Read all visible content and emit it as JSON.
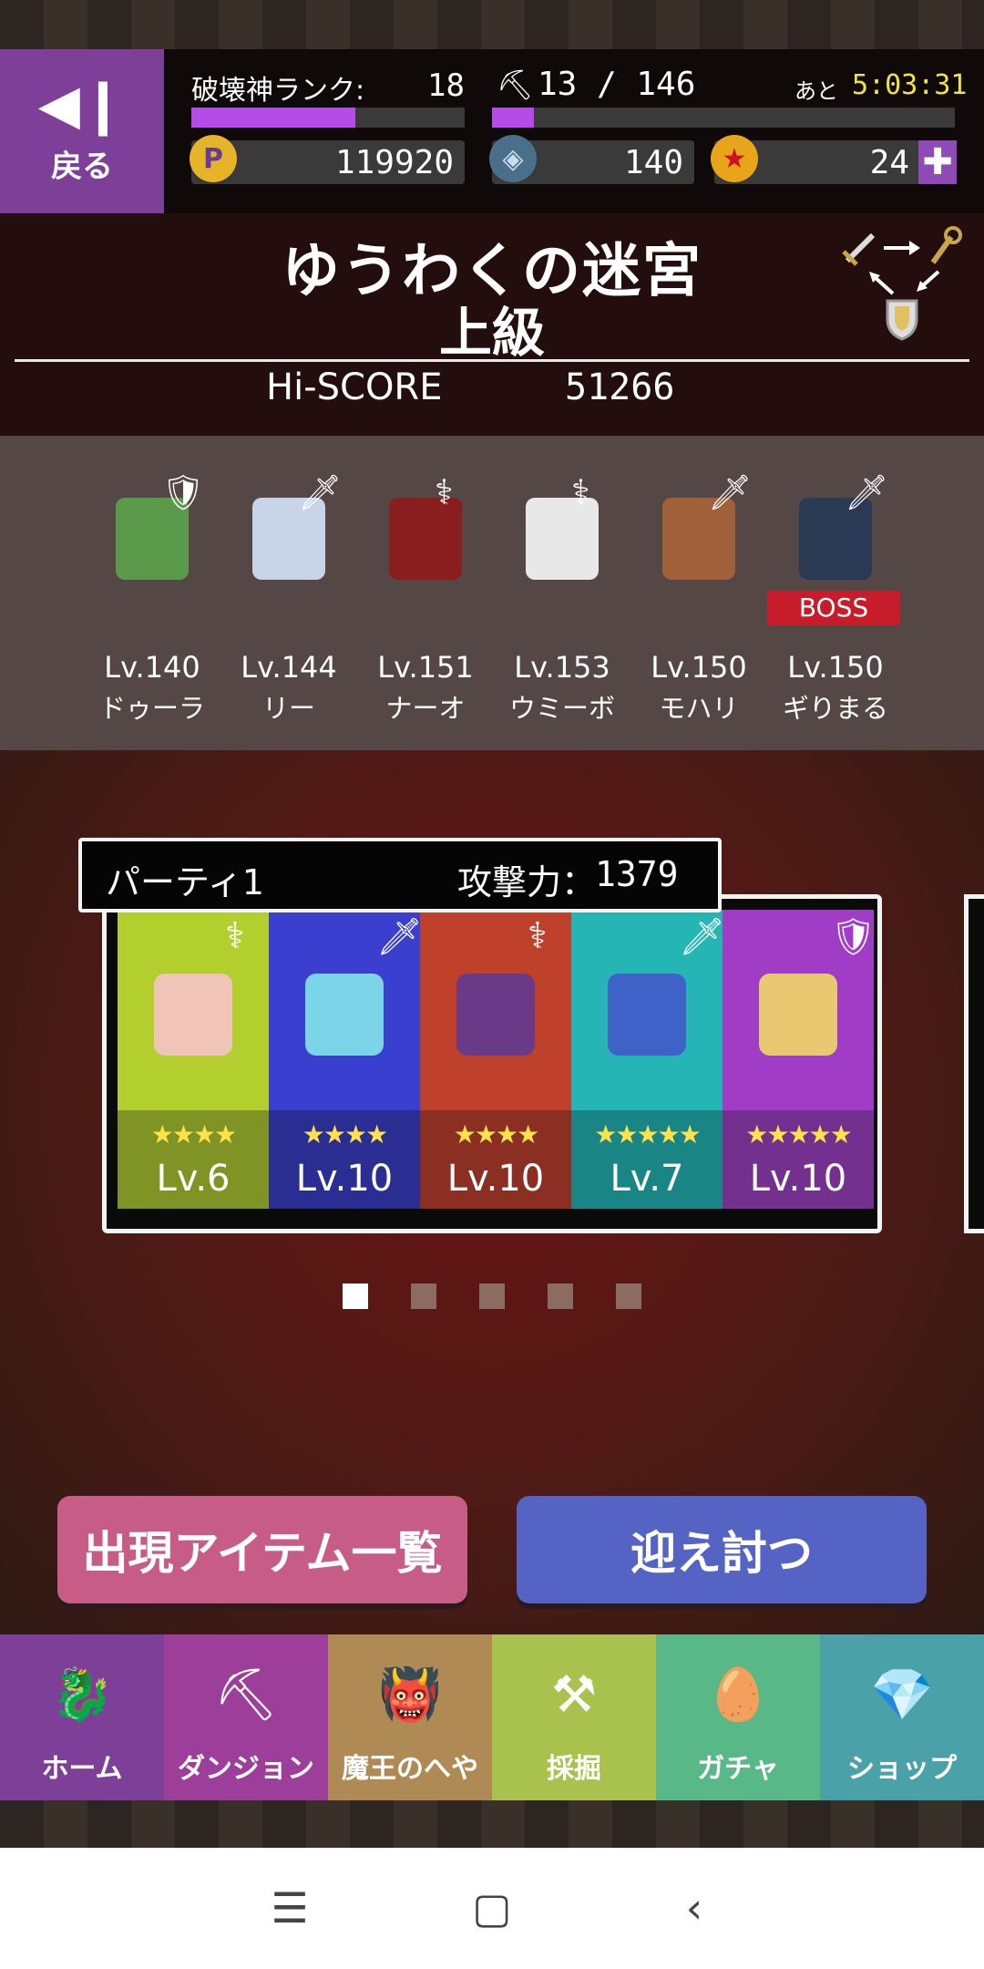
{
  "header": {
    "back_label": "戻る",
    "rank_label": "破壊神ランク:",
    "rank_value": "18",
    "rank_progress": 0.6,
    "stamina_value": "13 / 146",
    "stamina_progress": 0.09,
    "timer_label": "あと",
    "timer_value": "5:03:31",
    "points_icon": "P",
    "points_value": "119920",
    "crystal_value": "140",
    "gem_value": "24",
    "plus_label": "✚"
  },
  "dungeon": {
    "name": "ゆうわくの迷宮",
    "difficulty": "上級",
    "hiscore_label": "Hi-SCORE",
    "hiscore_value": "51266"
  },
  "enemies": [
    {
      "level": "Lv.140",
      "name": "ドゥーラ",
      "weapon": "shield-icon",
      "color": "#5a9a4a"
    },
    {
      "level": "Lv.144",
      "name": "リー",
      "weapon": "sword-icon",
      "color": "#c8d4e8"
    },
    {
      "level": "Lv.151",
      "name": "ナーオ",
      "weapon": "staff-icon",
      "color": "#8a1d1d"
    },
    {
      "level": "Lv.153",
      "name": "ウミーボ",
      "weapon": "staff-icon",
      "color": "#e8e8e8"
    },
    {
      "level": "Lv.150",
      "name": "モハリ",
      "weapon": "sword-icon",
      "color": "#a0603a"
    },
    {
      "level": "Lv.150",
      "name": "ギりまる",
      "weapon": "sword-icon",
      "color": "#2a3a55"
    }
  ],
  "boss_label": "BOSS",
  "party": {
    "name": "パーティ1",
    "attack_label": "攻撃力：",
    "attack_value": "1379",
    "monsters": [
      {
        "stars": "★★★★",
        "level": "Lv.6",
        "weapon": "staff-icon",
        "top_color": "#b3cf2d",
        "bottom_color": "#7f9424",
        "sprite_color": "#f1c4b8"
      },
      {
        "stars": "★★★★",
        "level": "Lv.10",
        "weapon": "sword-icon",
        "top_color": "#3b3fd0",
        "bottom_color": "#2a2d92",
        "sprite_color": "#7cd4e8"
      },
      {
        "stars": "★★★★",
        "level": "Lv.10",
        "weapon": "staff-icon",
        "top_color": "#c0412b",
        "bottom_color": "#8a2f22",
        "sprite_color": "#6a3a88"
      },
      {
        "stars": "★★★★★",
        "level": "Lv.7",
        "weapon": "sword-icon",
        "top_color": "#25b5b5",
        "bottom_color": "#1a8585",
        "sprite_color": "#3e62c8"
      },
      {
        "stars": "★★★★★",
        "level": "Lv.10",
        "weapon": "shield-icon",
        "top_color": "#a13cc7",
        "bottom_color": "#74308f",
        "sprite_color": "#e8c870"
      }
    ]
  },
  "page_dots": {
    "count": 5,
    "active": 0
  },
  "actions": {
    "items_label": "出現アイテム一覧",
    "fight_label": "迎え討つ"
  },
  "nav": [
    {
      "label": "ホーム",
      "icon": "dragon-icon",
      "color": "#7d3f98"
    },
    {
      "label": "ダンジョン",
      "icon": "pickaxe-icon",
      "color": "#9d3f9a"
    },
    {
      "label": "魔王のへや",
      "icon": "demon-lord-icon",
      "color": "#b08a55"
    },
    {
      "label": "採掘",
      "icon": "miner-icon",
      "color": "#a9c14d"
    },
    {
      "label": "ガチャ",
      "icon": "gacha-egg-icon",
      "color": "#59b887"
    },
    {
      "label": "ショップ",
      "icon": "shop-gem-icon",
      "color": "#4aa1a8"
    }
  ]
}
